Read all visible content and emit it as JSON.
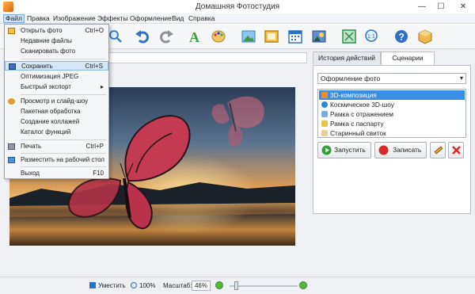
{
  "window": {
    "title": "Домашняя Фотостудия",
    "min": "—",
    "max": "☐",
    "close": "✕"
  },
  "menubar": [
    "Файл",
    "Правка",
    "Изображение",
    "Эффекты",
    "Оформление",
    "Вид",
    "Справка"
  ],
  "file_menu": {
    "items": [
      {
        "label": "Открыть фото",
        "shortcut": "Ctrl+O",
        "icon": "folder-open-icon"
      },
      {
        "label": "Недавние файлы",
        "shortcut": ""
      },
      {
        "label": "Сканировать фото",
        "shortcut": ""
      },
      {
        "label": "Сохранить",
        "shortcut": "Ctrl+S",
        "icon": "save-icon",
        "highlighted": true
      },
      {
        "label": "Оптимизация JPEG",
        "shortcut": ""
      },
      {
        "label": "Быстрый экспорт",
        "shortcut": "▸"
      },
      {
        "label": "Просмотр и слайд-шоу",
        "shortcut": "",
        "icon": "slideshow-icon"
      },
      {
        "label": "Пакетная обработка",
        "shortcut": ""
      },
      {
        "label": "Создание коллажей",
        "shortcut": ""
      },
      {
        "label": "Каталог функций",
        "shortcut": ""
      },
      {
        "label": "Печать",
        "shortcut": "Ctrl+P",
        "icon": "print-icon"
      },
      {
        "label": "Разместить на рабочий стол",
        "shortcut": "",
        "icon": "desktop-icon"
      },
      {
        "label": "Выход",
        "shortcut": "F10"
      }
    ]
  },
  "toolbar": [
    "zoom-icon",
    "undo-icon",
    "redo-icon",
    "text-icon",
    "palette-icon",
    "image-icon",
    "frame-icon",
    "calendar-icon",
    "photo-icon",
    "fit-icon",
    "actual-size-icon",
    "help-icon",
    "box-icon"
  ],
  "right_panel": {
    "tabs": [
      "История действий",
      "Сценарии"
    ],
    "active_tab": "Сценарии",
    "dropdown_value": "Оформление фото",
    "scenarios": [
      {
        "label": "3D-композиция",
        "selected": true
      },
      {
        "label": "Космическое 3D-шоу",
        "selected": false
      },
      {
        "label": "Рамка с отражением",
        "selected": false
      },
      {
        "label": "Рамка с паспарту",
        "selected": false
      },
      {
        "label": "Старинный свиток",
        "selected": false
      }
    ],
    "play_label": "Запустить",
    "record_label": "Записать"
  },
  "status": {
    "fit_label": "Уместить",
    "actual_label": "100%",
    "zoom_label": "Масштаб:",
    "zoom_value": "46%"
  },
  "colors": {
    "accent": "#3a8ee6",
    "play": "#2fa234",
    "record": "#d62a2a"
  }
}
